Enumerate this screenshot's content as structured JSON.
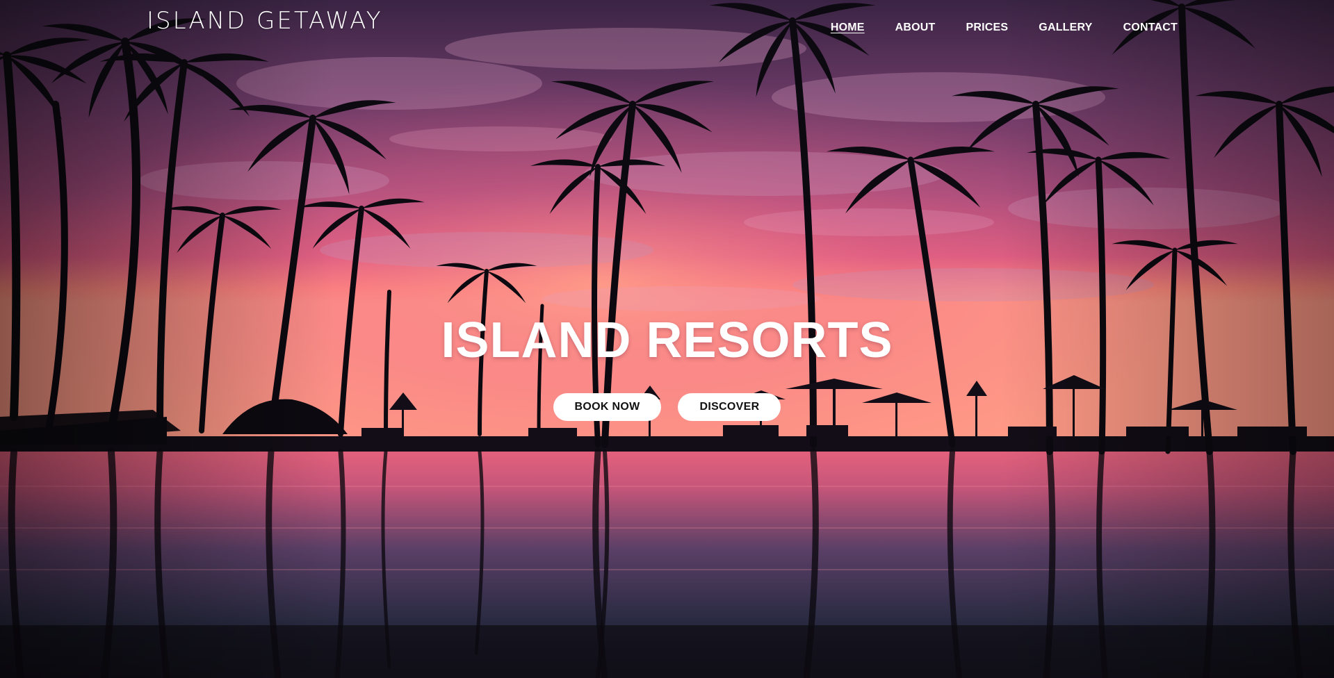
{
  "header": {
    "brand": "ISLAND GETAWAY",
    "nav": [
      {
        "label": "HOME",
        "active": true
      },
      {
        "label": "ABOUT",
        "active": false
      },
      {
        "label": "PRICES",
        "active": false
      },
      {
        "label": "GALLERY",
        "active": false
      },
      {
        "label": "CONTACT",
        "active": false
      }
    ]
  },
  "hero": {
    "image": "sunset-palm-resort-pool",
    "title": "ISLAND RESORTS",
    "buttons": [
      {
        "label": "BOOK NOW"
      },
      {
        "label": "DISCOVER"
      }
    ]
  },
  "colors": {
    "sky_top": "#3b2444",
    "sky_mid": "#a04a7a",
    "horizon_glow": "#ff7a7a",
    "water": "#2c2d44",
    "silhouette": "#0c0a10",
    "text": "#ffffff",
    "button_bg": "#ffffff",
    "button_text": "#111111"
  }
}
